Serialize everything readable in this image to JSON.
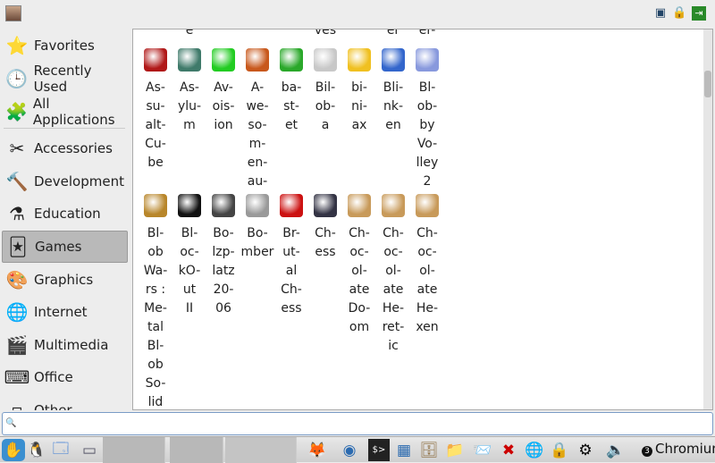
{
  "sidebar": {
    "items": [
      {
        "label": "Favorites",
        "icon": "star-icon",
        "glyph": "⭐"
      },
      {
        "label": "Recently Used",
        "icon": "clock-icon",
        "glyph": "🕒"
      },
      {
        "label": "All Applications",
        "icon": "applications-icon",
        "glyph": "🧩"
      },
      {
        "label": "Accessories",
        "icon": "accessories-icon",
        "glyph": "✂"
      },
      {
        "label": "Development",
        "icon": "hammer-icon",
        "glyph": "🔨"
      },
      {
        "label": "Education",
        "icon": "flask-icon",
        "glyph": "⚗"
      },
      {
        "label": "Games",
        "icon": "cards-icon",
        "glyph": "🃏",
        "selected": true
      },
      {
        "label": "Graphics",
        "icon": "palette-icon",
        "glyph": "🎨"
      },
      {
        "label": "Internet",
        "icon": "globe-icon",
        "glyph": "🌐"
      },
      {
        "label": "Multimedia",
        "icon": "clapperboard-icon",
        "glyph": "🎬"
      },
      {
        "label": "Office",
        "icon": "typewriter-icon",
        "glyph": "⌨"
      },
      {
        "label": "Other",
        "icon": "other-icon",
        "glyph": "▫"
      }
    ]
  },
  "top_fragments": [
    {
      "col": 1,
      "text": "e"
    },
    {
      "col": 5,
      "text": "ves"
    },
    {
      "col": 7,
      "text": "er"
    },
    {
      "col": 8,
      "text": "er-"
    }
  ],
  "apps": [
    {
      "lines": [
        "As-",
        "su-",
        "alt-",
        "Cu-",
        "be"
      ],
      "color": "#b01818"
    },
    {
      "lines": [
        "As-",
        "ylu-",
        "m"
      ],
      "color": "#3f7a6a"
    },
    {
      "lines": [
        "Av-",
        "ois-",
        "ion"
      ],
      "color": "#22cc22"
    },
    {
      "lines": [
        "A-",
        "we-",
        "so-",
        "m-",
        "en-",
        "au-"
      ],
      "color": "#c8581c"
    },
    {
      "lines": [
        "ba-",
        "st-",
        "et"
      ],
      "color": "#2aa82a"
    },
    {
      "lines": [
        "Bil-",
        "ob-",
        "a"
      ],
      "color": "#c8c8c8"
    },
    {
      "lines": [
        "bi-",
        "ni-",
        "ax"
      ],
      "color": "#f0c020"
    },
    {
      "lines": [
        "Bli-",
        "nk-",
        "en"
      ],
      "color": "#3366cc"
    },
    {
      "lines": [
        "Bl-",
        "ob-",
        "by",
        "Vo-",
        "lley",
        "2"
      ],
      "color": "#8899dd"
    },
    {
      "lines": [
        "Bl-",
        "ob",
        "Wa-",
        "rs :",
        "Me-",
        "tal",
        "Bl-",
        "ob",
        "So-",
        "lid"
      ],
      "color": "#b8862a"
    },
    {
      "lines": [
        "Bl-",
        "oc-",
        "kO-",
        "ut",
        "II"
      ],
      "color": "#111111"
    },
    {
      "lines": [
        "Bo-",
        "lzp-",
        "latz",
        "20-",
        "06"
      ],
      "color": "#444444"
    },
    {
      "lines": [
        "Bo-",
        "mber"
      ],
      "color": "#999999"
    },
    {
      "lines": [
        "Br-",
        "ut-",
        "al",
        "Ch-",
        "ess"
      ],
      "color": "#cc1111"
    },
    {
      "lines": [
        "Ch-",
        "ess"
      ],
      "color": "#333344"
    },
    {
      "lines": [
        "Ch-",
        "oc-",
        "ol-",
        "ate",
        "Do-",
        "om"
      ],
      "color": "#c89a5a"
    },
    {
      "lines": [
        "Ch-",
        "oc-",
        "ol-",
        "ate",
        "He-",
        "ret-",
        "ic"
      ],
      "color": "#c89a5a"
    },
    {
      "lines": [
        "Ch-",
        "oc-",
        "ol-",
        "ate",
        "He-",
        "xen"
      ],
      "color": "#c89a5a"
    }
  ],
  "search": {
    "value": "",
    "placeholder": ""
  },
  "taskbar": {
    "active_window": "Chromium",
    "window_count": "3"
  }
}
